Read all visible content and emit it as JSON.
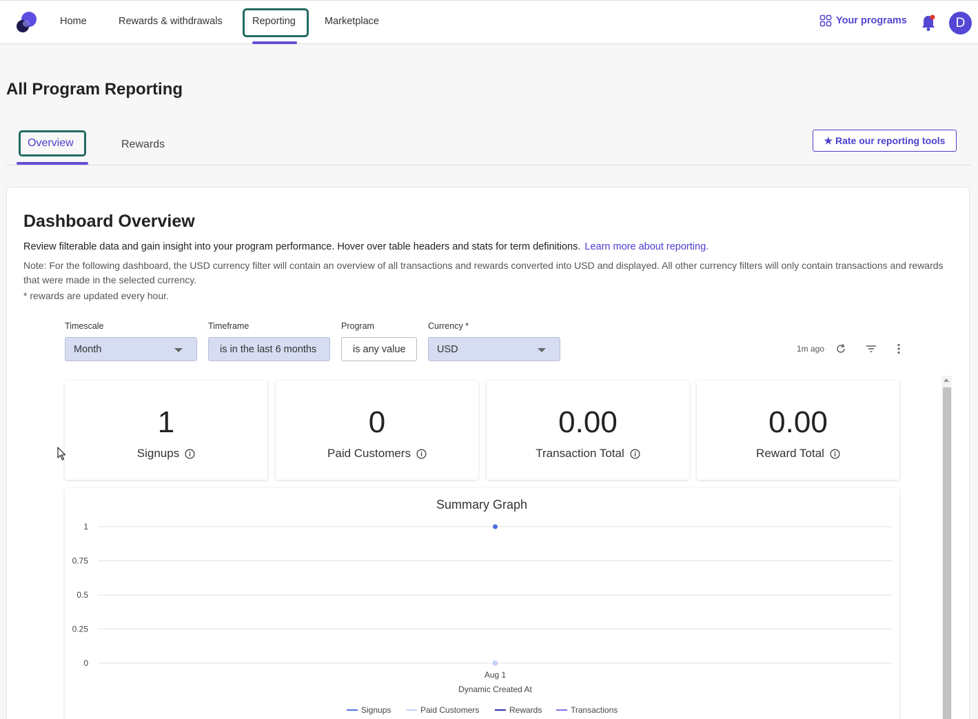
{
  "nav": {
    "items": [
      "Home",
      "Rewards & withdrawals",
      "Reporting",
      "Marketplace"
    ],
    "active": "Reporting",
    "your_programs": "Your programs",
    "avatar_letter": "D"
  },
  "page": {
    "title": "All Program Reporting"
  },
  "tabs": {
    "overview": "Overview",
    "rewards": "Rewards",
    "active": "Overview"
  },
  "rate_button": "★ Rate our reporting tools",
  "dashboard": {
    "title": "Dashboard Overview",
    "description": "Review filterable data and gain insight into your program performance. Hover over table headers and stats for term definitions.",
    "learn_more": "Learn more about reporting.",
    "note": "Note: For the following dashboard, the USD currency filter will contain an overview of all transactions and rewards converted into USD and displayed. All other currency filters will only contain transactions and rewards that were made in the selected currency.",
    "hourly": "* rewards are updated every hour."
  },
  "filters": {
    "timescale": {
      "label": "Timescale",
      "value": "Month"
    },
    "timeframe": {
      "label": "Timeframe",
      "value": "is in the last 6 months"
    },
    "program": {
      "label": "Program",
      "value": "is any value"
    },
    "currency": {
      "label": "Currency *",
      "value": "USD"
    },
    "updated": "1m ago"
  },
  "stats": [
    {
      "value": "1",
      "label": "Signups"
    },
    {
      "value": "0",
      "label": "Paid Customers"
    },
    {
      "value": "0.00",
      "label": "Transaction Total"
    },
    {
      "value": "0.00",
      "label": "Reward Total"
    }
  ],
  "colors": {
    "accent": "#4b3fcf",
    "focus_outline": "#236a62",
    "signups": "#4f6fe0",
    "paid_customers": "#c8d2f5",
    "rewards": "#2f2fa8",
    "transactions": "#7a70e8"
  },
  "chart_data": {
    "type": "line",
    "title": "Summary Graph",
    "xlabel": "Dynamic Created At",
    "ylabel": "",
    "categories": [
      "Aug 1"
    ],
    "ylim": [
      0,
      1
    ],
    "yticks": [
      "1",
      "0.75",
      "0.5",
      "0.25",
      "0"
    ],
    "grid": true,
    "legend_position": "bottom",
    "series": [
      {
        "name": "Signups",
        "values": [
          1
        ]
      },
      {
        "name": "Paid Customers",
        "values": [
          0
        ]
      },
      {
        "name": "Rewards",
        "values": [
          0
        ]
      },
      {
        "name": "Transactions",
        "values": [
          0
        ]
      }
    ]
  }
}
